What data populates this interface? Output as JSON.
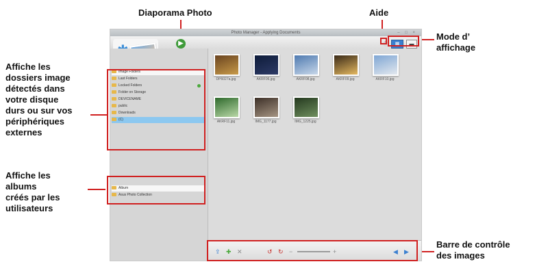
{
  "annotations": {
    "slideshow": "Diaporama Photo",
    "help": "Aide",
    "view_mode": [
      "Mode d’",
      "affichage"
    ],
    "folders": [
      "Affiche les",
      "dossiers image",
      "détectés dans",
      "votre disque",
      "durs ou sur vos",
      "périphériques",
      "externes"
    ],
    "albums": [
      "Affiche les",
      "albums",
      "créés par les",
      "utilisateurs"
    ],
    "control_bar": [
      "Barre de contrôle",
      "des images"
    ]
  },
  "app": {
    "title": "Photo Manager - Applying Documents",
    "tree": [
      {
        "label": "Image Folders",
        "style": "hdr"
      },
      {
        "label": "Last Folders",
        "style": ""
      },
      {
        "label": "Locked Folders",
        "style": "",
        "badge": true
      },
      {
        "label": "Folder on Storage",
        "style": ""
      },
      {
        "label": "DEVICENAME",
        "style": ""
      },
      {
        "label": "public",
        "style": ""
      },
      {
        "label": "Downloads",
        "style": ""
      },
      {
        "label": "(C)",
        "style": "sel"
      }
    ],
    "albums": [
      {
        "label": "Album",
        "style": "hdr"
      },
      {
        "label": "Asus Photo Collection",
        "style": ""
      }
    ],
    "thumbnails": [
      {
        "caption": "DP6027a.jpg",
        "color1": "#6a4420",
        "color2": "#c89a48"
      },
      {
        "caption": "AKRF06.jpg",
        "color1": "#0e1c3a",
        "color2": "#2d3a66"
      },
      {
        "caption": "AKRF08.jpg",
        "color1": "#4f7ab0",
        "color2": "#c7d7e9"
      },
      {
        "caption": "AKRF09.jpg",
        "color1": "#3a2a18",
        "color2": "#e4b860"
      },
      {
        "caption": "AKRF10.jpg",
        "color1": "#7fa6d4",
        "color2": "#e3e8ee"
      },
      {
        "caption": "AKRF11.jpg",
        "color1": "#2f6a2d",
        "color2": "#b9d8a7"
      },
      {
        "caption": "IMG_1177.jpg",
        "color1": "#3d3028",
        "color2": "#a69583"
      },
      {
        "caption": "IMG_1225.jpg",
        "color1": "#24391f",
        "color2": "#6f8f5e"
      }
    ]
  },
  "colors": {
    "annotation_red": "#d01f1f",
    "accent_blue": "#3a7fd0"
  }
}
